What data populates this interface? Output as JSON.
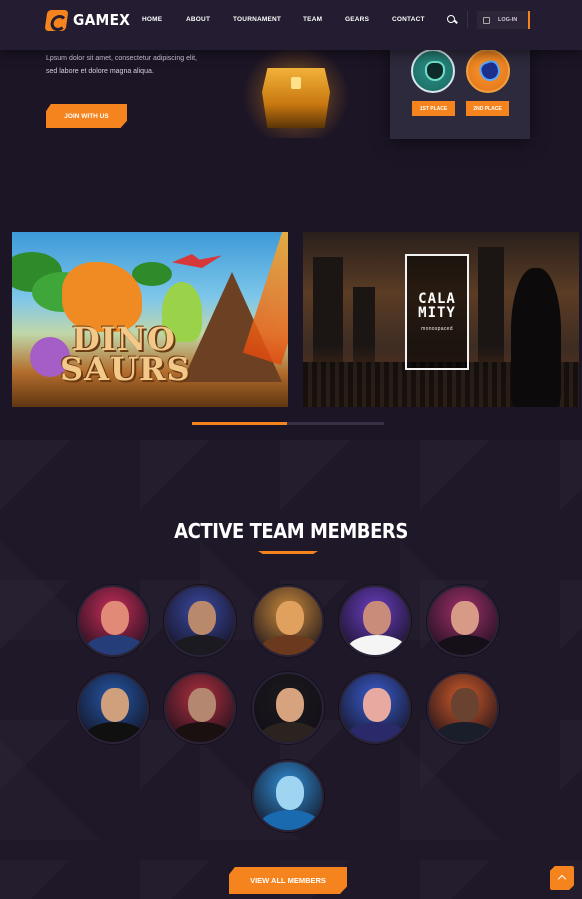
{
  "header": {
    "logo_text": "GAMEX",
    "nav": [
      "HOME",
      "ABOUT",
      "TOURNAMENT",
      "TEAM",
      "GEARS",
      "CONTACT"
    ],
    "login_label": "LOG-IN"
  },
  "hero": {
    "description": "Lpsum dolor sit amet, consectetur adipiscing elit, sed labore et dolore magna aliqua.",
    "join_label": "JOIN WITH US"
  },
  "tournament_card": {
    "first_place_label": "1ST PLACE",
    "second_place_label": "2ND PLACE"
  },
  "games": {
    "slides": [
      {
        "title_line1": "DINO",
        "title_line2": "SAURS"
      },
      {
        "title": "CALAMITY",
        "subtitle": "MONOSPACED"
      }
    ],
    "active_slide": 0.5
  },
  "team": {
    "title": "ACTIVE TEAM MEMBERS",
    "members": [
      {
        "name": "member-1",
        "bg": "#c92d5a",
        "face": "#e28a78",
        "body": "#253e7a"
      },
      {
        "name": "member-2",
        "bg": "#3a4aa2",
        "face": "#b9896c",
        "body": "#1a1a20"
      },
      {
        "name": "member-3",
        "bg": "#c98a3c",
        "face": "#e0a15f",
        "body": "#6b3a1e"
      },
      {
        "name": "member-4",
        "bg": "#6a3fc4",
        "face": "#c98c7a",
        "body": "#f5f5f5"
      },
      {
        "name": "member-5",
        "bg": "#a0306a",
        "face": "#d79a86",
        "body": "#151017"
      },
      {
        "name": "member-6",
        "bg": "#2458a8",
        "face": "#d0a07d",
        "body": "#101010"
      },
      {
        "name": "member-7",
        "bg": "#b03040",
        "face": "#b48770",
        "body": "#1b1010"
      },
      {
        "name": "member-8",
        "bg": "#1a1a1c",
        "face": "#d7a37f",
        "body": "#2a2320"
      },
      {
        "name": "member-9",
        "bg": "#3a5ed0",
        "face": "#e7a9a0",
        "body": "#2a2a6a"
      },
      {
        "name": "member-10",
        "bg": "#cf5a2a",
        "face": "#6a4230",
        "body": "#1a1e2a"
      },
      {
        "name": "member-11",
        "bg": "#2f8fd6",
        "face": "#9fd5f0",
        "body": "#1a6ab0"
      }
    ],
    "view_all_label": "VIEW ALL MEMBERS"
  },
  "colors": {
    "accent": "#f5841f",
    "background": "#1c1526",
    "header": "#241c30"
  }
}
